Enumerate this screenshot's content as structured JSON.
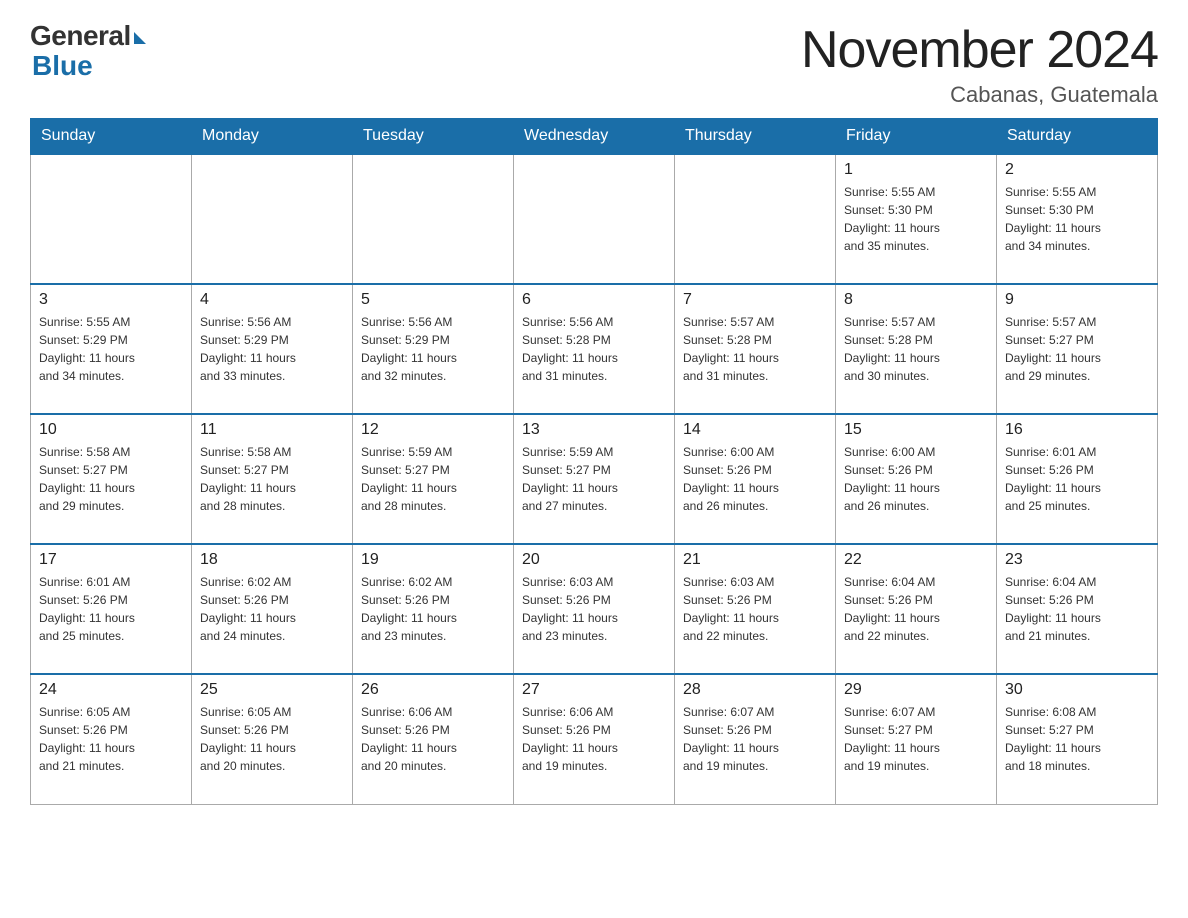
{
  "header": {
    "logo_general": "General",
    "logo_blue": "Blue",
    "month_title": "November 2024",
    "location": "Cabanas, Guatemala"
  },
  "weekdays": [
    "Sunday",
    "Monday",
    "Tuesday",
    "Wednesday",
    "Thursday",
    "Friday",
    "Saturday"
  ],
  "weeks": [
    [
      {
        "day": "",
        "info": ""
      },
      {
        "day": "",
        "info": ""
      },
      {
        "day": "",
        "info": ""
      },
      {
        "day": "",
        "info": ""
      },
      {
        "day": "",
        "info": ""
      },
      {
        "day": "1",
        "info": "Sunrise: 5:55 AM\nSunset: 5:30 PM\nDaylight: 11 hours\nand 35 minutes."
      },
      {
        "day": "2",
        "info": "Sunrise: 5:55 AM\nSunset: 5:30 PM\nDaylight: 11 hours\nand 34 minutes."
      }
    ],
    [
      {
        "day": "3",
        "info": "Sunrise: 5:55 AM\nSunset: 5:29 PM\nDaylight: 11 hours\nand 34 minutes."
      },
      {
        "day": "4",
        "info": "Sunrise: 5:56 AM\nSunset: 5:29 PM\nDaylight: 11 hours\nand 33 minutes."
      },
      {
        "day": "5",
        "info": "Sunrise: 5:56 AM\nSunset: 5:29 PM\nDaylight: 11 hours\nand 32 minutes."
      },
      {
        "day": "6",
        "info": "Sunrise: 5:56 AM\nSunset: 5:28 PM\nDaylight: 11 hours\nand 31 minutes."
      },
      {
        "day": "7",
        "info": "Sunrise: 5:57 AM\nSunset: 5:28 PM\nDaylight: 11 hours\nand 31 minutes."
      },
      {
        "day": "8",
        "info": "Sunrise: 5:57 AM\nSunset: 5:28 PM\nDaylight: 11 hours\nand 30 minutes."
      },
      {
        "day": "9",
        "info": "Sunrise: 5:57 AM\nSunset: 5:27 PM\nDaylight: 11 hours\nand 29 minutes."
      }
    ],
    [
      {
        "day": "10",
        "info": "Sunrise: 5:58 AM\nSunset: 5:27 PM\nDaylight: 11 hours\nand 29 minutes."
      },
      {
        "day": "11",
        "info": "Sunrise: 5:58 AM\nSunset: 5:27 PM\nDaylight: 11 hours\nand 28 minutes."
      },
      {
        "day": "12",
        "info": "Sunrise: 5:59 AM\nSunset: 5:27 PM\nDaylight: 11 hours\nand 28 minutes."
      },
      {
        "day": "13",
        "info": "Sunrise: 5:59 AM\nSunset: 5:27 PM\nDaylight: 11 hours\nand 27 minutes."
      },
      {
        "day": "14",
        "info": "Sunrise: 6:00 AM\nSunset: 5:26 PM\nDaylight: 11 hours\nand 26 minutes."
      },
      {
        "day": "15",
        "info": "Sunrise: 6:00 AM\nSunset: 5:26 PM\nDaylight: 11 hours\nand 26 minutes."
      },
      {
        "day": "16",
        "info": "Sunrise: 6:01 AM\nSunset: 5:26 PM\nDaylight: 11 hours\nand 25 minutes."
      }
    ],
    [
      {
        "day": "17",
        "info": "Sunrise: 6:01 AM\nSunset: 5:26 PM\nDaylight: 11 hours\nand 25 minutes."
      },
      {
        "day": "18",
        "info": "Sunrise: 6:02 AM\nSunset: 5:26 PM\nDaylight: 11 hours\nand 24 minutes."
      },
      {
        "day": "19",
        "info": "Sunrise: 6:02 AM\nSunset: 5:26 PM\nDaylight: 11 hours\nand 23 minutes."
      },
      {
        "day": "20",
        "info": "Sunrise: 6:03 AM\nSunset: 5:26 PM\nDaylight: 11 hours\nand 23 minutes."
      },
      {
        "day": "21",
        "info": "Sunrise: 6:03 AM\nSunset: 5:26 PM\nDaylight: 11 hours\nand 22 minutes."
      },
      {
        "day": "22",
        "info": "Sunrise: 6:04 AM\nSunset: 5:26 PM\nDaylight: 11 hours\nand 22 minutes."
      },
      {
        "day": "23",
        "info": "Sunrise: 6:04 AM\nSunset: 5:26 PM\nDaylight: 11 hours\nand 21 minutes."
      }
    ],
    [
      {
        "day": "24",
        "info": "Sunrise: 6:05 AM\nSunset: 5:26 PM\nDaylight: 11 hours\nand 21 minutes."
      },
      {
        "day": "25",
        "info": "Sunrise: 6:05 AM\nSunset: 5:26 PM\nDaylight: 11 hours\nand 20 minutes."
      },
      {
        "day": "26",
        "info": "Sunrise: 6:06 AM\nSunset: 5:26 PM\nDaylight: 11 hours\nand 20 minutes."
      },
      {
        "day": "27",
        "info": "Sunrise: 6:06 AM\nSunset: 5:26 PM\nDaylight: 11 hours\nand 19 minutes."
      },
      {
        "day": "28",
        "info": "Sunrise: 6:07 AM\nSunset: 5:26 PM\nDaylight: 11 hours\nand 19 minutes."
      },
      {
        "day": "29",
        "info": "Sunrise: 6:07 AM\nSunset: 5:27 PM\nDaylight: 11 hours\nand 19 minutes."
      },
      {
        "day": "30",
        "info": "Sunrise: 6:08 AM\nSunset: 5:27 PM\nDaylight: 11 hours\nand 18 minutes."
      }
    ]
  ]
}
